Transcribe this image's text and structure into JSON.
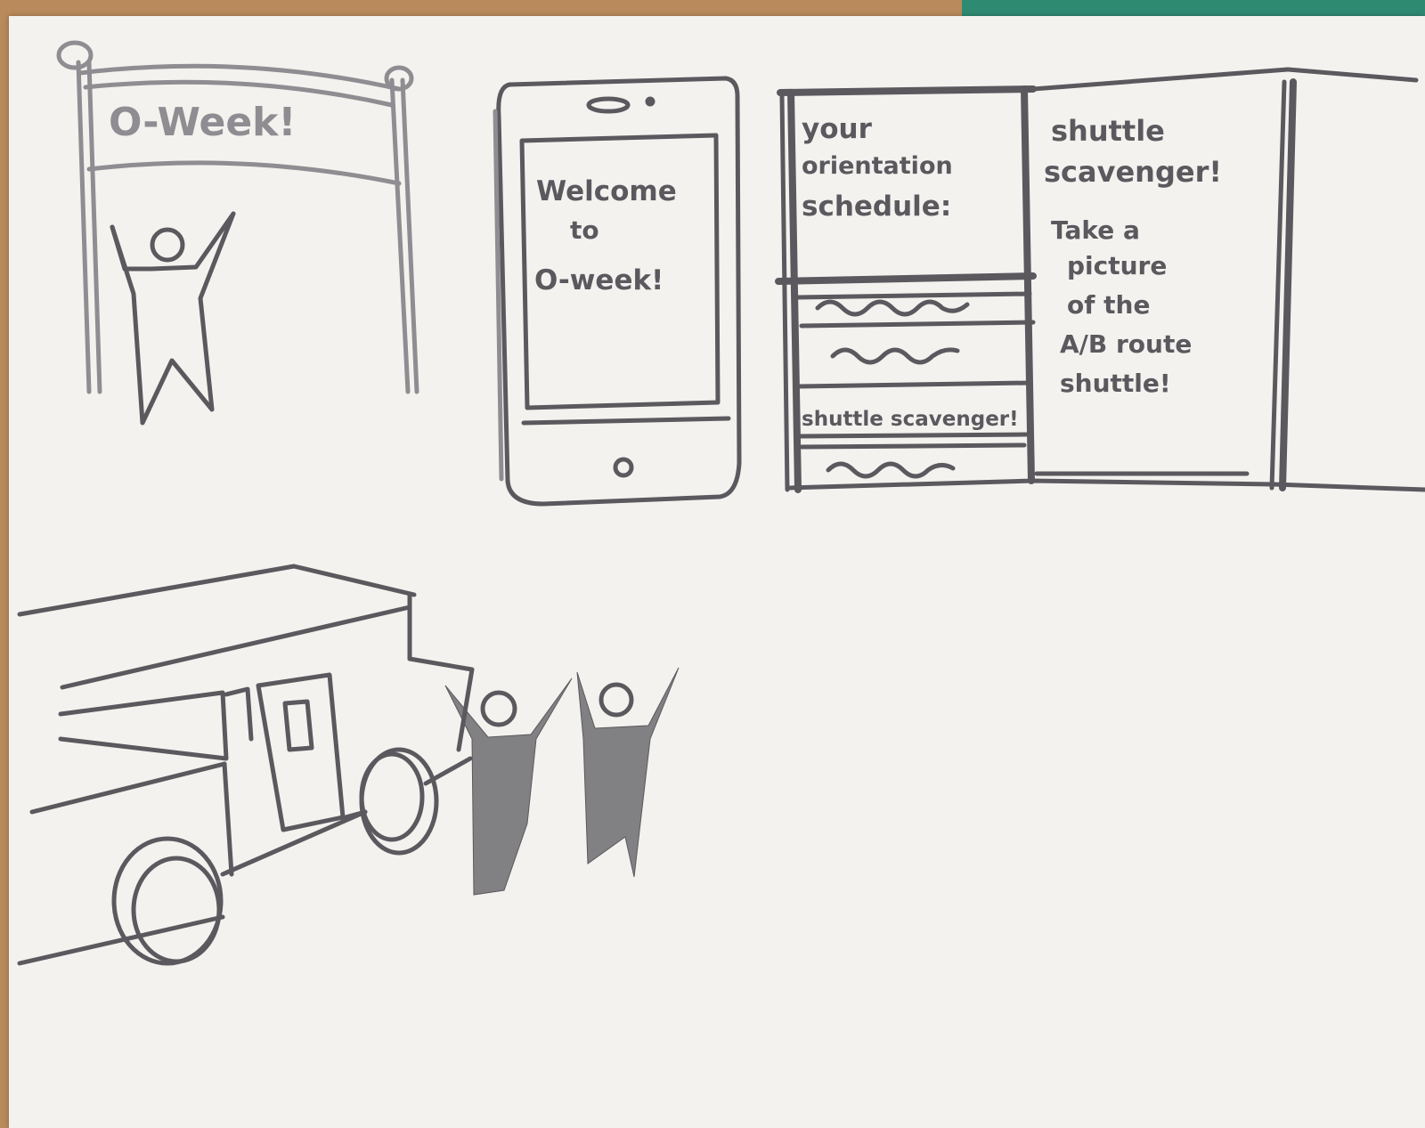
{
  "banner": {
    "text": "O-Week!"
  },
  "phone": {
    "line1": "Welcome",
    "line2": "to",
    "line3": "O-week!"
  },
  "schedule": {
    "heading_line1": "your",
    "heading_line2": "orientation",
    "heading_line3": "schedule:",
    "rows": [
      "",
      "",
      "shuttle scavenger!",
      ""
    ]
  },
  "scavenger": {
    "title_line1": "shuttle",
    "title_line2": "scavenger!",
    "body": [
      "Take a",
      "picture",
      "of the",
      "A/B route",
      "shuttle!"
    ]
  }
}
